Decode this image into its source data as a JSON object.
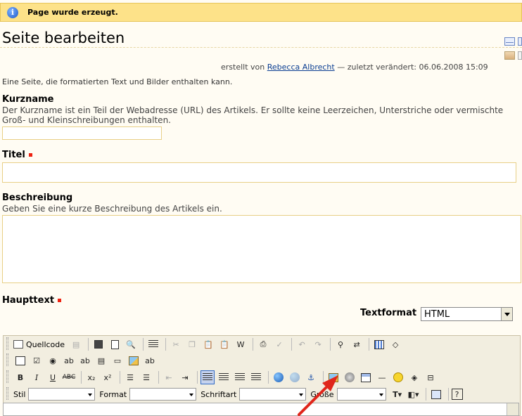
{
  "status": {
    "message": "Page wurde erzeugt.",
    "icon": "info-icon"
  },
  "page": {
    "title": "Seite bearbeiten",
    "byline_prefix": "erstellt von",
    "author": "Rebecca Albrecht",
    "byline_suffix": "— zuletzt verändert: 06.06.2008 15:09",
    "description": "Eine Seite, die formatierten Text und Bilder enthalten kann."
  },
  "fields": {
    "kurzname": {
      "label": "Kurzname",
      "help": "Der Kurzname ist ein Teil der Webadresse (URL) des Artikels. Er sollte keine Leerzeichen, Unterstriche oder vermischte Groß- und Kleinschreibungen enthalten.",
      "value": ""
    },
    "titel": {
      "label": "Titel",
      "value": ""
    },
    "beschreibung": {
      "label": "Beschreibung",
      "help": "Geben Sie eine kurze Beschreibung des Artikels ein.",
      "value": ""
    },
    "haupttext": {
      "label": "Haupttext"
    },
    "textformat": {
      "label": "Textformat",
      "value": "HTML"
    }
  },
  "toolbar": {
    "quellcode": "Quellcode",
    "stil": "Stil",
    "format": "Format",
    "schriftart": "Schriftart",
    "groesse": "Größe",
    "bold": "B",
    "italic": "I",
    "underline": "U",
    "strike": "ABC",
    "sub": "x₂",
    "sup": "x²",
    "help": "?"
  },
  "colors": {
    "status_bg": "#fde289",
    "required": "#ee2211",
    "arrow": "#e0261b",
    "link": "#0a3d91"
  }
}
